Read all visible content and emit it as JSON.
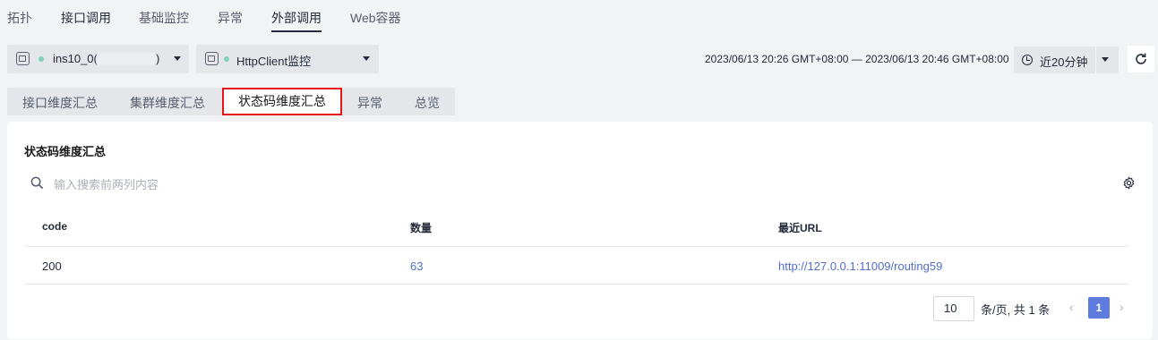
{
  "top_tabs": [
    "拓扑",
    "接口调用",
    "基础监控",
    "异常",
    "外部调用",
    "Web容器"
  ],
  "instance_select": {
    "value": "ins10_0(1",
    "suffix": ")"
  },
  "monitor_select": {
    "value": "HttpClient监控"
  },
  "time_range": {
    "text": "2023/06/13 20:26 GMT+08:00 — 2023/06/13 20:46 GMT+08:00"
  },
  "quick_range": {
    "label": "近20分钟"
  },
  "sub_tabs": [
    "接口维度汇总",
    "集群维度汇总",
    "状态码维度汇总",
    "异常",
    "总览"
  ],
  "card": {
    "title": "状态码维度汇总",
    "search_placeholder": "输入搜索前两列内容"
  },
  "table": {
    "columns": [
      "code",
      "数量",
      "最近URL"
    ],
    "rows": [
      {
        "code": "200",
        "count": "63",
        "url": "http://127.0.0.1:11009/routing59"
      }
    ]
  },
  "pagination": {
    "page_size": "10",
    "info": "条/页, 共 1 条",
    "current_page": "1",
    "prev": "‹",
    "next": "›"
  },
  "colors": {
    "active_tab_highlight": "#e8141b",
    "link": "#526ecc",
    "page_active": "#5e7ce0",
    "status_dot": "#7fd4b6"
  }
}
